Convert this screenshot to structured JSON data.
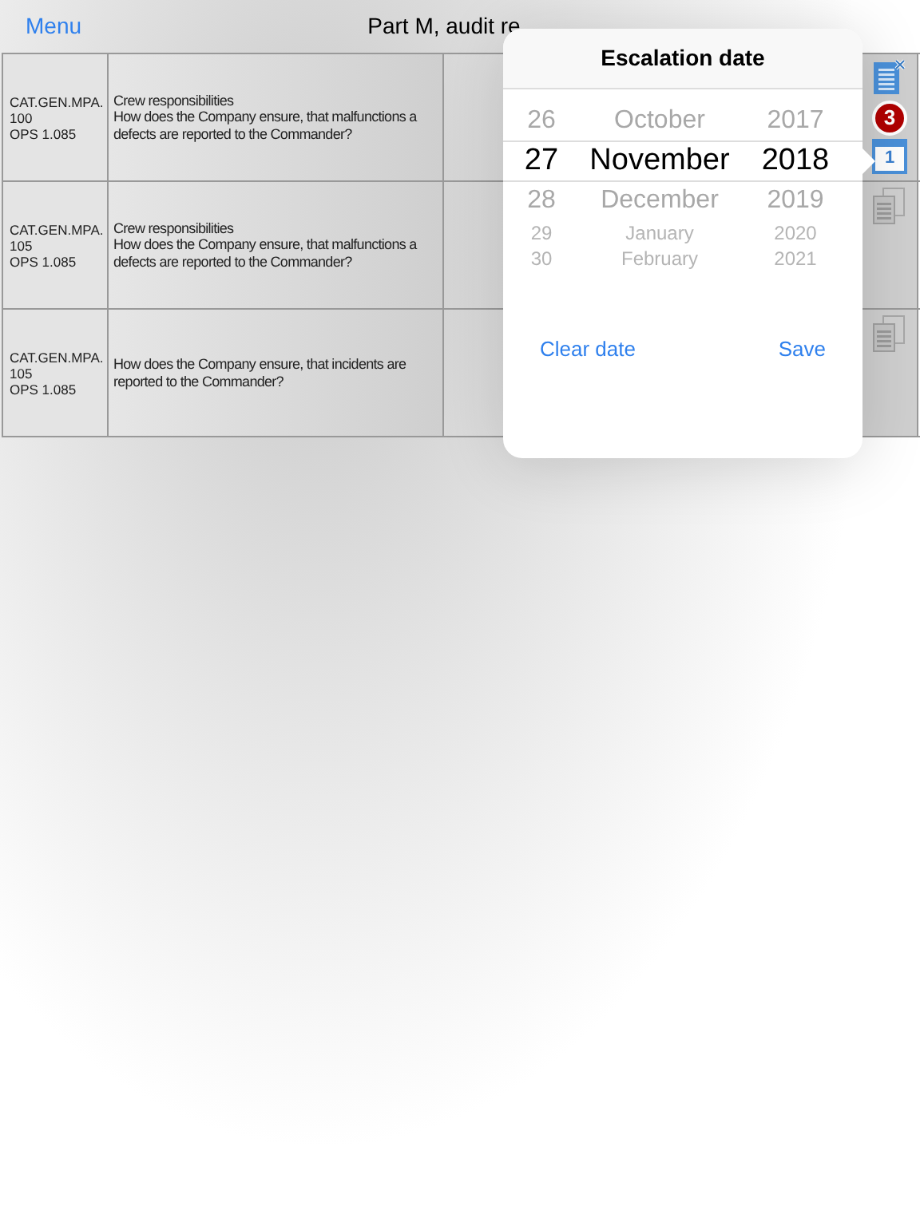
{
  "nav": {
    "back": "Menu",
    "title": "Part M, audit re"
  },
  "table": {
    "rows": [
      {
        "ref": [
          "CAT.GEN.MPA.",
          "100",
          "OPS 1.085"
        ],
        "question": [
          "Crew responsibilities",
          "How does the Company ensure, that malfunctions a",
          "defects are reported to the Commander?"
        ],
        "badge": "3",
        "calendar_day": "1",
        "kind": "active"
      },
      {
        "ref": [
          "CAT.GEN.MPA.",
          "105",
          "OPS 1.085"
        ],
        "question": [
          "Crew responsibilities",
          "How does the Company ensure, that malfunctions a",
          "defects are reported to the Commander?"
        ],
        "kind": "copy"
      },
      {
        "ref": [
          "CAT.GEN.MPA.",
          "105",
          "OPS 1.085"
        ],
        "question": [
          "How does the Company ensure, that incidents are",
          "reported to the Commander?"
        ],
        "kind": "copy"
      }
    ]
  },
  "popover": {
    "title": "Escalation date",
    "picker": [
      {
        "day": "26",
        "month": "October",
        "year": "2017",
        "selected": false
      },
      {
        "day": "27",
        "month": "November",
        "year": "2018",
        "selected": true
      },
      {
        "day": "28",
        "month": "December",
        "year": "2019",
        "selected": false
      },
      {
        "day": "29",
        "month": "January",
        "year": "2020",
        "selected": false
      },
      {
        "day": "30",
        "month": "February",
        "year": "2021",
        "selected": false
      }
    ],
    "buttons": [
      "Clear date",
      "Save"
    ]
  }
}
